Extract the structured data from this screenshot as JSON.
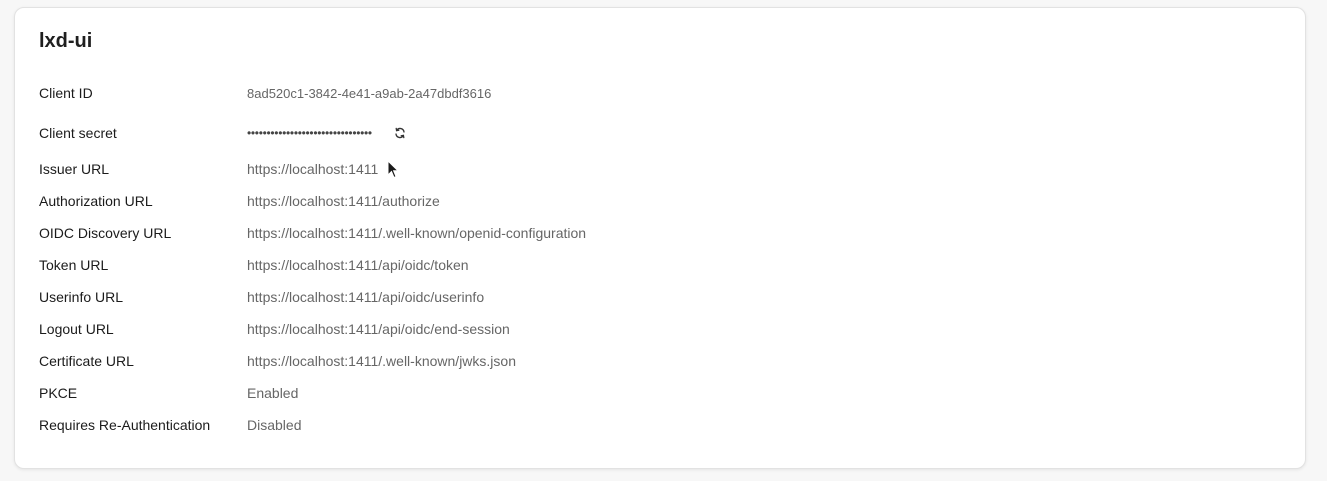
{
  "client": {
    "name": "lxd-ui"
  },
  "fields": {
    "client_id": {
      "label": "Client ID",
      "value": "8ad520c1-3842-4e41-a9ab-2a47dbdf3616"
    },
    "client_secret": {
      "label": "Client secret",
      "value": "••••••••••••••••••••••••••••••••",
      "regenerate_icon": "refresh-icon"
    },
    "issuer_url": {
      "label": "Issuer URL",
      "value": "https://localhost:1411"
    },
    "authorization_url": {
      "label": "Authorization URL",
      "value": "https://localhost:1411/authorize"
    },
    "oidc_discovery_url": {
      "label": "OIDC Discovery URL",
      "value": "https://localhost:1411/.well-known/openid-configuration"
    },
    "token_url": {
      "label": "Token URL",
      "value": "https://localhost:1411/api/oidc/token"
    },
    "userinfo_url": {
      "label": "Userinfo URL",
      "value": "https://localhost:1411/api/oidc/userinfo"
    },
    "logout_url": {
      "label": "Logout URL",
      "value": "https://localhost:1411/api/oidc/end-session"
    },
    "certificate_url": {
      "label": "Certificate URL",
      "value": "https://localhost:1411/.well-known/jwks.json"
    },
    "pkce": {
      "label": "PKCE",
      "value": "Enabled"
    },
    "requires_reauth": {
      "label": "Requires Re-Authentication",
      "value": "Disabled"
    }
  }
}
